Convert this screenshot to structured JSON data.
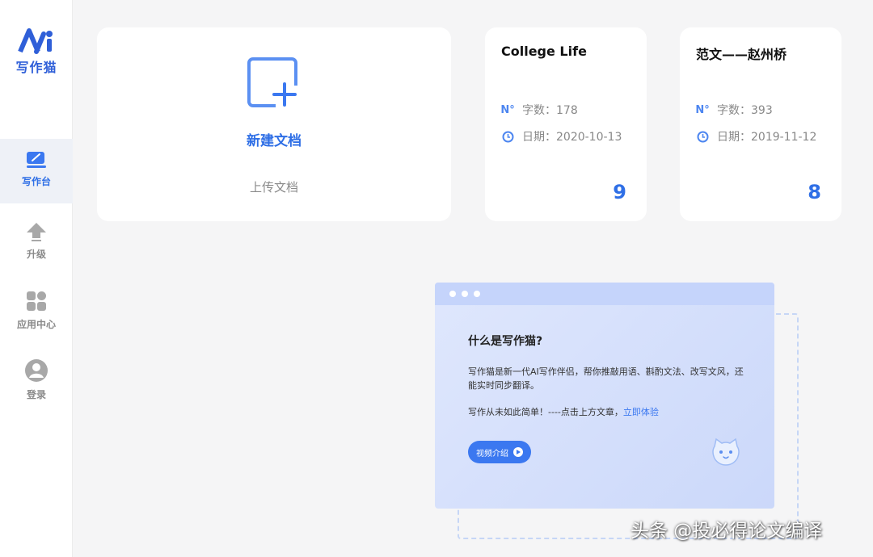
{
  "app": {
    "logo_text": "写作猫"
  },
  "sidebar": {
    "items": [
      {
        "label": "写作台",
        "icon": "edit-icon",
        "active": true
      },
      {
        "label": "升级",
        "icon": "upload-arrow-icon",
        "active": false
      },
      {
        "label": "应用中心",
        "icon": "grid-icon",
        "active": false
      },
      {
        "label": "登录",
        "icon": "user-icon",
        "active": false
      }
    ]
  },
  "workspace": {
    "new_doc_label": "新建文档",
    "upload_label": "上传文档",
    "documents": [
      {
        "title": "College Life",
        "word_count_label": "字数：178",
        "date_label": "日期：2020-10-13",
        "score": "9"
      },
      {
        "title": "范文——赵州桥",
        "word_count_label": "字数：393",
        "date_label": "日期：2019-11-12",
        "score": "8"
      }
    ]
  },
  "intro": {
    "title": "什么是写作猫?",
    "description": "写作猫是新一代AI写作伴侣，帮你推敲用语、斟酌文法、改写文风，还能实时同步翻译。",
    "tagline": "写作从未如此简单！----点击上方文章，",
    "try_link": "立即体验",
    "video_button": "视频介绍"
  },
  "watermark": "头条 @投必得论文编译",
  "colors": {
    "accent": "#2f6fe6",
    "sidebar_bg": "#ffffff",
    "page_bg": "#f5f5f6"
  }
}
